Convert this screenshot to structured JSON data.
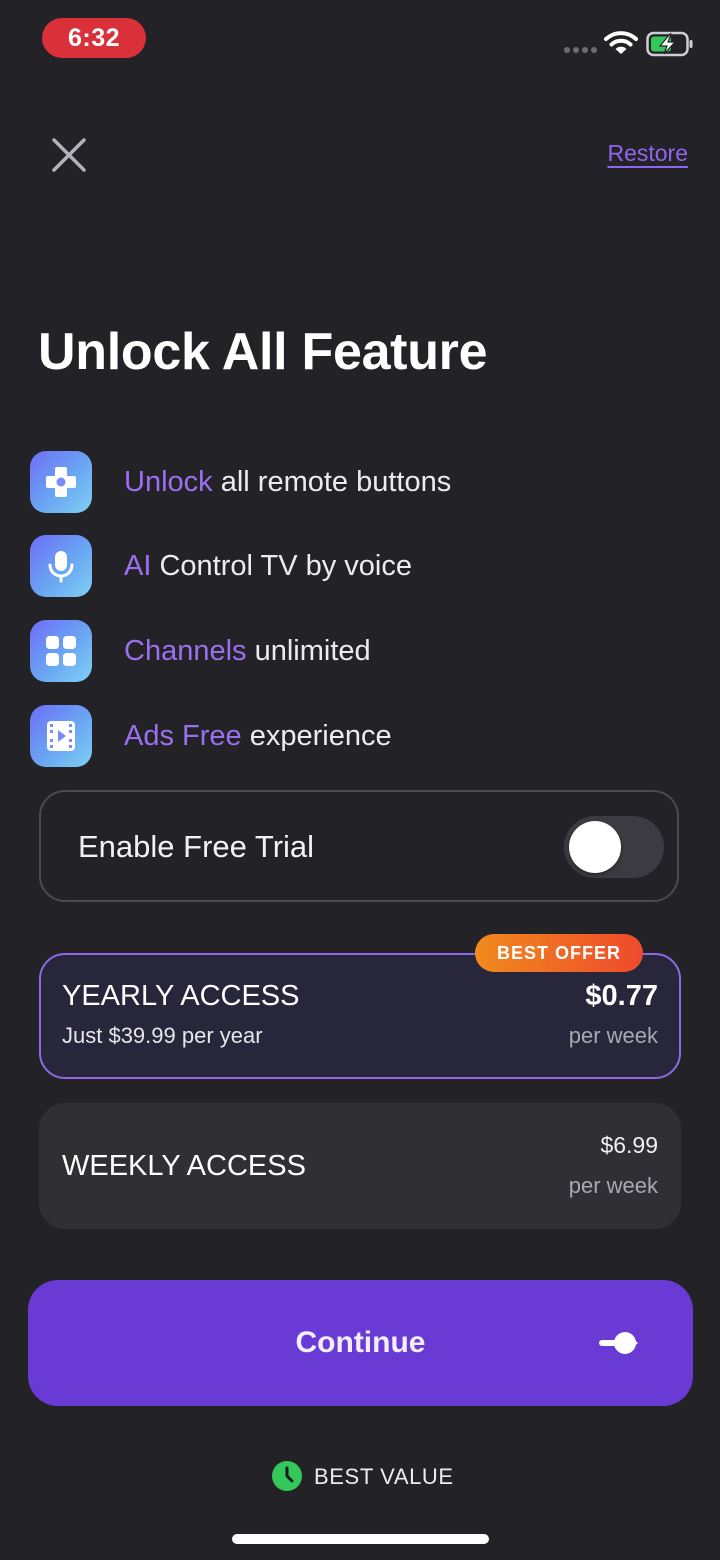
{
  "status_bar": {
    "time": "6:32"
  },
  "header": {
    "close_icon": "close-icon",
    "restore_label": "Restore"
  },
  "title": "Unlock All Feature",
  "features": [
    {
      "icon": "gamepad-icon",
      "highlight": "Unlock",
      "rest": " all remote buttons"
    },
    {
      "icon": "microphone-icon",
      "highlight": "AI",
      "rest": " Control TV by voice"
    },
    {
      "icon": "grid-icon",
      "highlight": "Channels",
      "rest": " unlimited"
    },
    {
      "icon": "video-play-icon",
      "highlight": "Ads Free",
      "rest": " experience"
    }
  ],
  "free_trial": {
    "label": "Enable Free Trial",
    "enabled": false
  },
  "plans": {
    "yearly": {
      "badge": "BEST OFFER",
      "name": "YEARLY ACCESS",
      "subtitle": "Just $39.99 per year",
      "price": "$0.77",
      "unit": "per week",
      "selected": true
    },
    "weekly": {
      "name": "WEEKLY ACCESS",
      "price": "$6.99",
      "unit": "per week",
      "selected": false
    }
  },
  "continue_label": "Continue",
  "footer": {
    "best_value": "BEST VALUE",
    "icon": "clock-icon"
  },
  "colors": {
    "background": "#232226",
    "accent": "#6a3ad4",
    "highlight_text": "#9a70f0",
    "badge_start": "#f08a1e",
    "badge_end": "#ef4a2c",
    "status_pill": "#d9303a",
    "clock_green": "#34c759"
  }
}
